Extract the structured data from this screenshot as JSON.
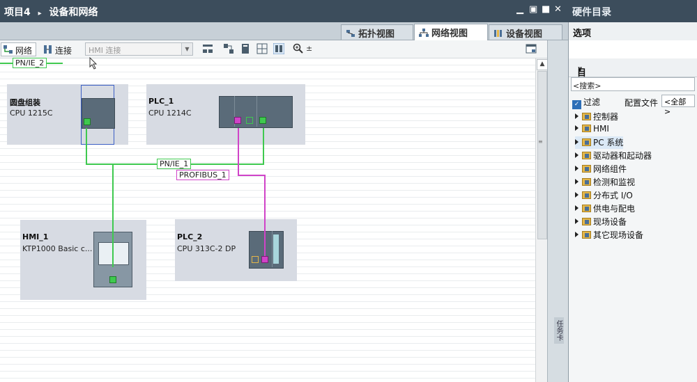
{
  "title": {
    "project": "项目4",
    "sep": "▸",
    "editor": "设备和网络",
    "controls": [
      "▁",
      "▣",
      "■",
      "✕"
    ]
  },
  "tabs": [
    {
      "label": "拓扑视图",
      "active": false
    },
    {
      "label": "网络视图",
      "active": true
    },
    {
      "label": "设备视图",
      "active": false
    }
  ],
  "toolbar": {
    "network_label": "网络",
    "connect_label": "连接",
    "hmi_combo": "HMI 连接",
    "zoom_extra": "±"
  },
  "canvas": {
    "net_top_label": "PN/IE_2",
    "net_pn1_label": "PN/IE_1",
    "net_profibus_label": "PROFIBUS_1",
    "colors": {
      "profinet": "#3fc94f",
      "profibus": "#d043c8",
      "device_bg": "#d7dbe3",
      "selected_border": "#3b5fc4"
    },
    "devices": [
      {
        "id": "yuanpan",
        "name": "圆盘组装",
        "type": "CPU 1215C"
      },
      {
        "id": "plc1",
        "name": "PLC_1",
        "type": "CPU 1214C"
      },
      {
        "id": "hmi1",
        "name": "HMI_1",
        "type": "KTP1000 Basic c..."
      },
      {
        "id": "plc2",
        "name": "PLC_2",
        "type": "CPU 313C-2 DP"
      }
    ]
  },
  "side_strip": {
    "vertical_text": "任务卡"
  },
  "right_panel": {
    "title": "硬件目录",
    "options_label": "选项",
    "catalog_label": "目录",
    "search_placeholder": "<搜索>",
    "filter_label": "过滤",
    "profile_label": "配置文件",
    "profile_value": "<全部>",
    "tree": [
      {
        "label": "控制器",
        "selected": false
      },
      {
        "label": "HMI",
        "selected": false
      },
      {
        "label": "PC 系统",
        "selected": true
      },
      {
        "label": "驱动器和起动器",
        "selected": false
      },
      {
        "label": "网络组件",
        "selected": false
      },
      {
        "label": "检测和监视",
        "selected": false
      },
      {
        "label": "分布式 I/O",
        "selected": false
      },
      {
        "label": "供电与配电",
        "selected": false
      },
      {
        "label": "现场设备",
        "selected": false
      },
      {
        "label": "其它现场设备",
        "selected": false
      }
    ]
  }
}
